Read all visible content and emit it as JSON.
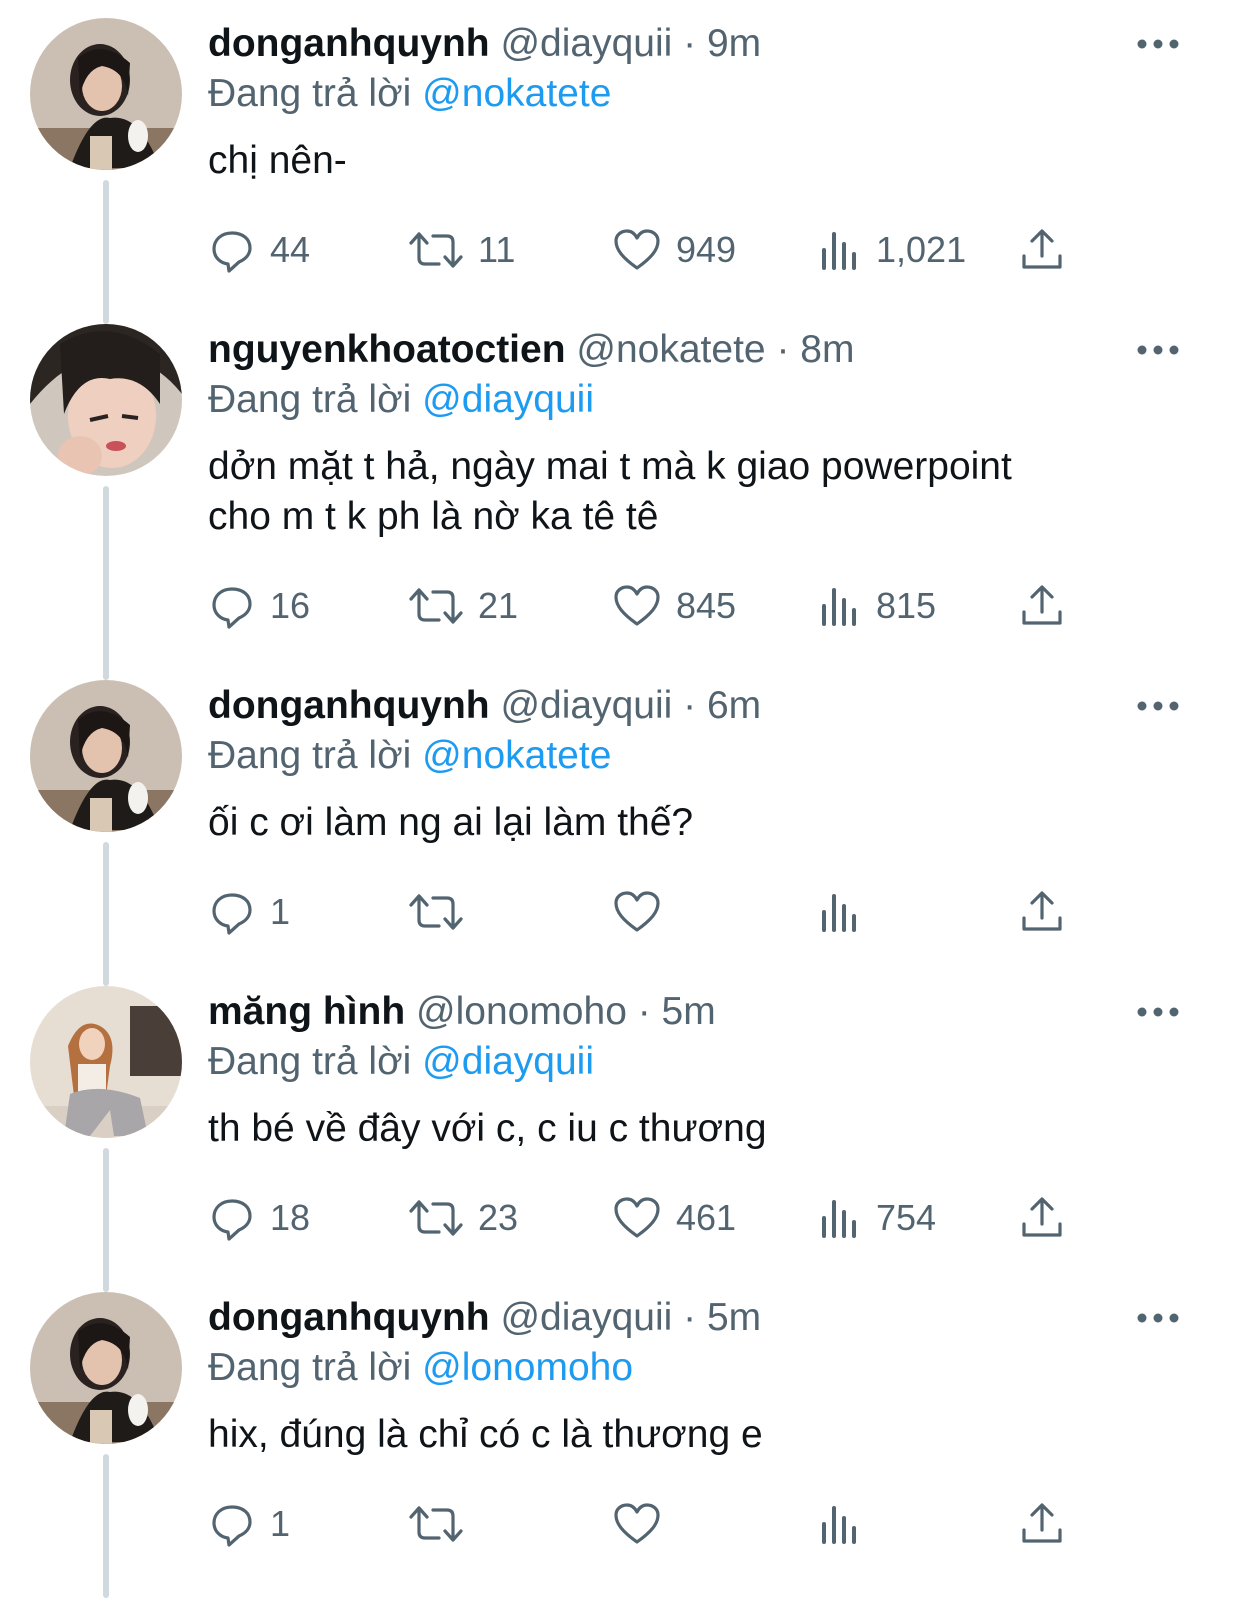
{
  "colors": {
    "text_primary": "#0f1419",
    "text_secondary": "#536471",
    "link": "#1d9bf0",
    "thread_line": "#cfd9de"
  },
  "reply_prefix": "Đang trả lời",
  "tweets": [
    {
      "display_name": "donganhquynh",
      "handle": "@diayquii",
      "time": "· 9m",
      "reply_to": "@nokatete",
      "text_lines": [
        "chị nên-"
      ],
      "counts": {
        "replies": "44",
        "retweets": "11",
        "likes": "949",
        "views": "1,021"
      }
    },
    {
      "display_name": "nguyenkhoatoctien",
      "handle": "@nokatete",
      "time": "· 8m",
      "reply_to": "@diayquii",
      "text_lines": [
        "dởn mặt t hả, ngày mai t mà k giao powerpoint",
        "cho m t k ph là nờ ka tê tê"
      ],
      "counts": {
        "replies": "16",
        "retweets": "21",
        "likes": "845",
        "views": "815"
      }
    },
    {
      "display_name": "donganhquynh",
      "handle": "@diayquii",
      "time": "· 6m",
      "reply_to": "@nokatete",
      "text_lines": [
        "ối c ơi làm ng ai lại làm thế?"
      ],
      "counts": {
        "replies": "1",
        "retweets": "",
        "likes": "",
        "views": ""
      }
    },
    {
      "display_name": "măng hình",
      "handle": "@lonomoho",
      "time": "· 5m",
      "reply_to": "@diayquii",
      "text_lines": [
        "th bé về đây với c, c iu c thương"
      ],
      "counts": {
        "replies": "18",
        "retweets": "23",
        "likes": "461",
        "views": "754"
      }
    },
    {
      "display_name": "donganhquynh",
      "handle": "@diayquii",
      "time": "· 5m",
      "reply_to": "@lonomoho",
      "text_lines": [
        "hix, đúng là chỉ có c là thương e"
      ],
      "counts": {
        "replies": "1",
        "retweets": "",
        "likes": "",
        "views": ""
      }
    }
  ]
}
